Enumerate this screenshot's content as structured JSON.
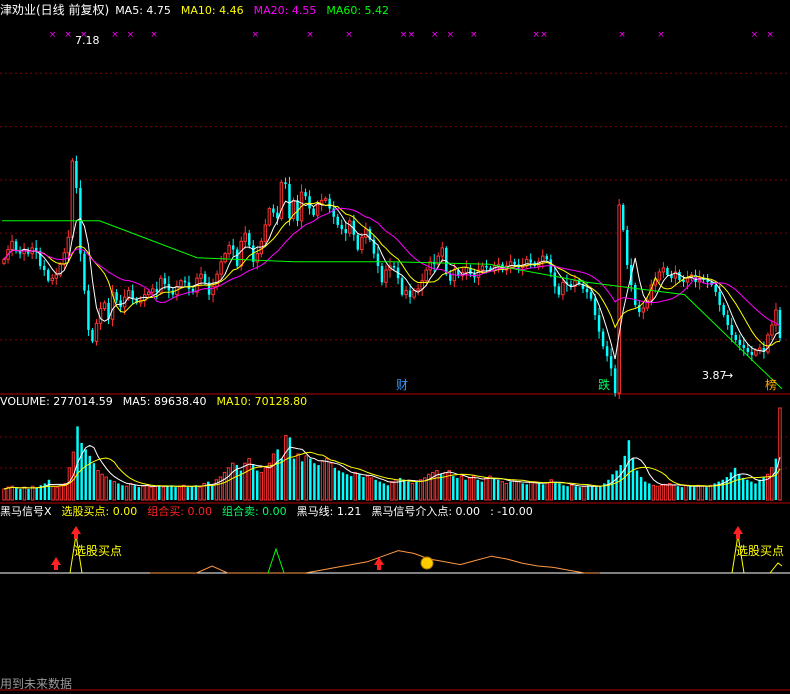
{
  "chart_data": [
    {
      "type": "candlestick",
      "header": {
        "title": "津劝业(日线 前复权)",
        "items": [
          {
            "label": "MA5",
            "value": "4.75",
            "color": "#ffffff"
          },
          {
            "label": "MA10",
            "value": "4.46",
            "color": "#ffff00"
          },
          {
            "label": "MA20",
            "value": "4.55",
            "color": "#ff00ff"
          },
          {
            "label": "MA60",
            "value": "5.42",
            "color": "#00ff00"
          }
        ]
      },
      "ylim": [
        3.35,
        7.9
      ],
      "annotations": {
        "high_label": "7.18",
        "low_label": "3.87",
        "low_arrow": "→"
      },
      "price_series_csv": "4.98,5.1,5.2,5.08,5.05,5.09,5.05,5.12,5.08,4.9,4.85,4.72,4.75,4.79,4.92,5.06,5.25,6.18,5.85,5.05,4.6,4.12,3.98,4.2,4.38,4.45,4.25,4.58,4.48,4.4,4.52,4.6,4.5,4.45,4.48,4.55,4.58,4.62,4.58,4.75,4.68,4.6,4.55,4.65,4.72,4.7,4.62,4.58,4.75,4.8,4.7,4.55,4.65,4.8,4.95,5.05,5.15,5.1,4.9,5.2,5.3,5.15,4.95,5.05,5.2,5.4,5.6,5.55,5.48,5.92,5.9,5.48,5.7,5.45,5.8,5.75,5.6,5.52,5.65,5.7,5.72,5.6,5.5,5.4,5.35,5.3,5.45,5.28,5.1,5.25,5.35,5.22,5.05,4.9,4.7,4.85,4.9,4.88,4.75,4.55,4.6,4.52,4.6,4.62,4.72,4.85,4.95,4.92,5.02,5.12,4.8,4.72,4.85,4.78,4.82,4.88,4.8,4.76,4.85,4.9,4.88,4.85,4.9,4.92,4.85,4.9,4.95,4.92,4.88,4.9,4.98,4.94,4.9,4.95,5.02,4.98,4.82,4.65,4.55,4.7,4.68,4.65,4.72,4.68,4.62,4.58,4.5,4.3,4.1,3.92,3.8,3.65,3.35,3.05,2.8,2.45,2.25,2.05,1.98,2.02,2.1,2.25,2.3,2.38,2.42,2.35,2.32,2.38,2.3,2.28,2.32,2.35,2.28,2.32,2.3,2.28,2.25,2.18,2.05,1.95,1.85,1.75,1.7,1.65,1.62,1.58,1.55,1.6,1.62,1.58,1.75,1.85,2.0,1.72",
      "ma60_series": [
        5.45,
        5.45,
        5.0,
        4.95,
        4.95,
        4.92,
        4.7,
        4.55,
        3.4
      ],
      "signal_labels": [
        {
          "text": "财",
          "color": "#3399ff"
        },
        {
          "text": "跌",
          "color": "#00ff66"
        },
        {
          "text": "榜",
          "color": "#ffaa00"
        }
      ]
    },
    {
      "type": "bar",
      "header": {
        "items": [
          {
            "label": "VOLUME",
            "value": "277014.59",
            "color": "#ffffff"
          },
          {
            "label": "MA5",
            "value": "89638.40",
            "color": "#ffffff"
          },
          {
            "label": "MA10",
            "value": "70128.80",
            "color": "#ffff00"
          }
        ]
      },
      "ylim": [
        0,
        277014.59
      ],
      "volume_series_csv": "12,14,15,13,12,14,12,15,13,16,18,22,15,14,16,18,35,52,80,62,55,48,40,32,28,25,22,20,18,16,15,18,16,14,15,16,14,15,16,14,15,16,14,15,16,14,15,16,14,18,20,16,22,25,30,35,40,38,32,40,45,38,32,30,35,40,50,55,45,70,68,45,50,42,48,45,40,38,42,45,40,35,32,30,28,26,30,28,25,26,24,22,20,18,16,20,22,24,22,20,18,20,22,24,28,30,32,28,30,32,26,24,26,22,24,26,22,20,24,26,24,22,20,18,20,22,20,18,17,19,20,18,17,19,22,20,18,16,15,16,15,14,15,16,15,14,15,18,22,28,32,38,48,65,45,32,25,20,18,16,15,16,17,18,16,15,14,16,15,14,16,15,14,16,18,20,22,25,30,35,28,24,22,20,18,22,25,28,35,45,100"
    },
    {
      "type": "line",
      "header": {
        "items": [
          {
            "label": "黑马信号X",
            "value": "",
            "color": "#ffffff"
          },
          {
            "label": "选股买点",
            "value": "0.00",
            "color": "#ffff00"
          },
          {
            "label": "组合买",
            "value": "0.00",
            "color": "#ff2222"
          },
          {
            "label": "组合卖",
            "value": "0.00",
            "color": "#00ff66"
          },
          {
            "label": "黑马线",
            "value": "1.21",
            "color": "#ffffff"
          },
          {
            "label": "黑马信号介入点",
            "value": "0.00",
            "color": "#ffffff"
          },
          {
            "label": "",
            "value": "-10.00",
            "color": "#ffffff"
          }
        ]
      },
      "wave_series": [
        0,
        0,
        0,
        0,
        0.5,
        0,
        0,
        0,
        0,
        0,
        0,
        0.2,
        0.4,
        0.6,
        0.8,
        1.2,
        1.6,
        1.4,
        1.0,
        0.8,
        0.6,
        0.9,
        1.2,
        1.0,
        0.7,
        0.5,
        0.4,
        0.2,
        0,
        0
      ],
      "signal_markers": [
        {
          "kind": "arrow-marker"
        },
        {
          "kind": "arrow-marker",
          "label": "选股买点"
        },
        {
          "kind": "arrow-marker"
        },
        {
          "kind": "coin-marker"
        },
        {
          "kind": "arrow-marker",
          "label": "选股买点"
        }
      ],
      "footer_text": "用到未来数据"
    }
  ]
}
